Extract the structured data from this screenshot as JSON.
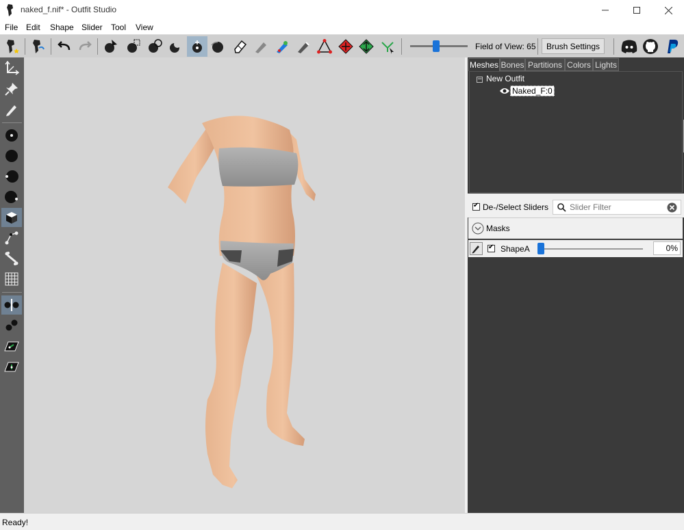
{
  "window": {
    "title": "naked_f.nif* - Outfit Studio"
  },
  "menu": [
    "File",
    "Edit",
    "Shape",
    "Slider",
    "Tool",
    "View"
  ],
  "toolbar": {
    "fov_label": "Field of View: 65",
    "fov_value": 65,
    "brush_settings_label": "Brush Settings"
  },
  "panel": {
    "tabs": [
      "Meshes",
      "Bones",
      "Partitions",
      "Colors",
      "Lights"
    ],
    "active_tab": "Meshes",
    "tree": {
      "root": "New Outfit",
      "child": "Naked_F:0"
    }
  },
  "sliders": {
    "deselect_label": "De-/Select Sliders",
    "filter_placeholder": "Slider Filter",
    "masks_label": "Masks",
    "items": [
      {
        "name": "ShapeA",
        "value_label": "0%",
        "value": 0
      }
    ]
  },
  "status": {
    "text": "Ready!"
  },
  "colors": {
    "accent": "#1a73d9",
    "panel_dark": "#3a3a3a",
    "viewport": "#d6d6d6"
  }
}
